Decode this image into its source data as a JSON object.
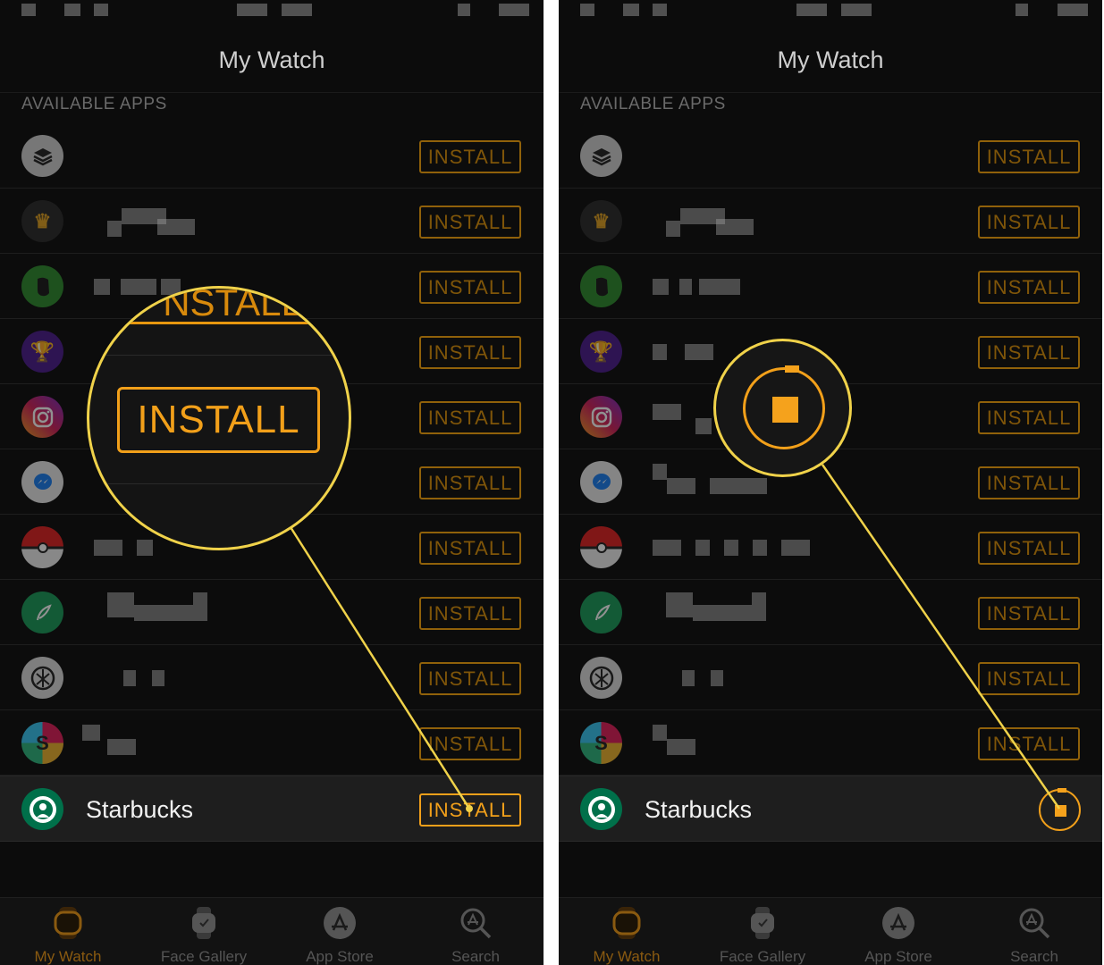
{
  "left": {
    "nav_title": "My Watch",
    "section_header": "AVAILABLE APPS",
    "install_label": "INSTALL",
    "featured_app": "Starbucks",
    "zoom_label": "INSTALL",
    "zoom_partial": "NSTALL"
  },
  "right": {
    "nav_title": "My Watch",
    "section_header": "AVAILABLE APPS",
    "install_label": "INSTALL",
    "featured_app": "Starbucks",
    "featured_state": "downloading"
  },
  "apps_icons": [
    "buffer-icon",
    "draftkings-icon",
    "evernote-icon",
    "trophy-icon",
    "instagram-icon",
    "messenger-icon",
    "pokeball-icon",
    "robinhood-icon",
    "knot-icon",
    "slack-icon"
  ],
  "tabs": [
    {
      "label": "My Watch",
      "icon": "watch-icon",
      "active": true
    },
    {
      "label": "Face Gallery",
      "icon": "watch-face-icon",
      "active": false
    },
    {
      "label": "App Store",
      "icon": "app-store-icon",
      "active": false
    },
    {
      "label": "Search",
      "icon": "search-icon",
      "active": false
    }
  ],
  "colors": {
    "accent": "#f2a01a",
    "callout": "#f0d24a",
    "background": "#0c0c0c",
    "starbucks": "#00704a"
  }
}
